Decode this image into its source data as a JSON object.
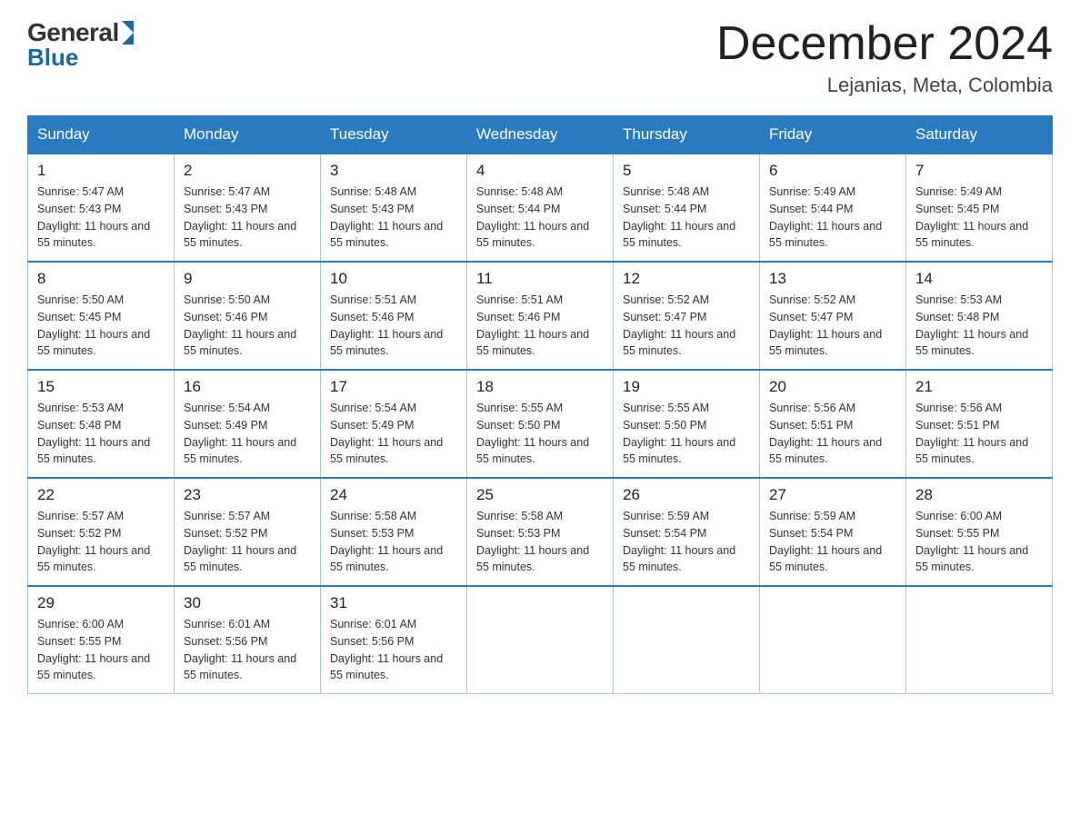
{
  "logo": {
    "general": "General",
    "blue": "Blue"
  },
  "header": {
    "month": "December 2024",
    "location": "Lejanias, Meta, Colombia"
  },
  "days_of_week": [
    "Sunday",
    "Monday",
    "Tuesday",
    "Wednesday",
    "Thursday",
    "Friday",
    "Saturday"
  ],
  "weeks": [
    {
      "days": [
        {
          "number": "1",
          "sunrise": "Sunrise: 5:47 AM",
          "sunset": "Sunset: 5:43 PM",
          "daylight": "Daylight: 11 hours and 55 minutes."
        },
        {
          "number": "2",
          "sunrise": "Sunrise: 5:47 AM",
          "sunset": "Sunset: 5:43 PM",
          "daylight": "Daylight: 11 hours and 55 minutes."
        },
        {
          "number": "3",
          "sunrise": "Sunrise: 5:48 AM",
          "sunset": "Sunset: 5:43 PM",
          "daylight": "Daylight: 11 hours and 55 minutes."
        },
        {
          "number": "4",
          "sunrise": "Sunrise: 5:48 AM",
          "sunset": "Sunset: 5:44 PM",
          "daylight": "Daylight: 11 hours and 55 minutes."
        },
        {
          "number": "5",
          "sunrise": "Sunrise: 5:48 AM",
          "sunset": "Sunset: 5:44 PM",
          "daylight": "Daylight: 11 hours and 55 minutes."
        },
        {
          "number": "6",
          "sunrise": "Sunrise: 5:49 AM",
          "sunset": "Sunset: 5:44 PM",
          "daylight": "Daylight: 11 hours and 55 minutes."
        },
        {
          "number": "7",
          "sunrise": "Sunrise: 5:49 AM",
          "sunset": "Sunset: 5:45 PM",
          "daylight": "Daylight: 11 hours and 55 minutes."
        }
      ]
    },
    {
      "days": [
        {
          "number": "8",
          "sunrise": "Sunrise: 5:50 AM",
          "sunset": "Sunset: 5:45 PM",
          "daylight": "Daylight: 11 hours and 55 minutes."
        },
        {
          "number": "9",
          "sunrise": "Sunrise: 5:50 AM",
          "sunset": "Sunset: 5:46 PM",
          "daylight": "Daylight: 11 hours and 55 minutes."
        },
        {
          "number": "10",
          "sunrise": "Sunrise: 5:51 AM",
          "sunset": "Sunset: 5:46 PM",
          "daylight": "Daylight: 11 hours and 55 minutes."
        },
        {
          "number": "11",
          "sunrise": "Sunrise: 5:51 AM",
          "sunset": "Sunset: 5:46 PM",
          "daylight": "Daylight: 11 hours and 55 minutes."
        },
        {
          "number": "12",
          "sunrise": "Sunrise: 5:52 AM",
          "sunset": "Sunset: 5:47 PM",
          "daylight": "Daylight: 11 hours and 55 minutes."
        },
        {
          "number": "13",
          "sunrise": "Sunrise: 5:52 AM",
          "sunset": "Sunset: 5:47 PM",
          "daylight": "Daylight: 11 hours and 55 minutes."
        },
        {
          "number": "14",
          "sunrise": "Sunrise: 5:53 AM",
          "sunset": "Sunset: 5:48 PM",
          "daylight": "Daylight: 11 hours and 55 minutes."
        }
      ]
    },
    {
      "days": [
        {
          "number": "15",
          "sunrise": "Sunrise: 5:53 AM",
          "sunset": "Sunset: 5:48 PM",
          "daylight": "Daylight: 11 hours and 55 minutes."
        },
        {
          "number": "16",
          "sunrise": "Sunrise: 5:54 AM",
          "sunset": "Sunset: 5:49 PM",
          "daylight": "Daylight: 11 hours and 55 minutes."
        },
        {
          "number": "17",
          "sunrise": "Sunrise: 5:54 AM",
          "sunset": "Sunset: 5:49 PM",
          "daylight": "Daylight: 11 hours and 55 minutes."
        },
        {
          "number": "18",
          "sunrise": "Sunrise: 5:55 AM",
          "sunset": "Sunset: 5:50 PM",
          "daylight": "Daylight: 11 hours and 55 minutes."
        },
        {
          "number": "19",
          "sunrise": "Sunrise: 5:55 AM",
          "sunset": "Sunset: 5:50 PM",
          "daylight": "Daylight: 11 hours and 55 minutes."
        },
        {
          "number": "20",
          "sunrise": "Sunrise: 5:56 AM",
          "sunset": "Sunset: 5:51 PM",
          "daylight": "Daylight: 11 hours and 55 minutes."
        },
        {
          "number": "21",
          "sunrise": "Sunrise: 5:56 AM",
          "sunset": "Sunset: 5:51 PM",
          "daylight": "Daylight: 11 hours and 55 minutes."
        }
      ]
    },
    {
      "days": [
        {
          "number": "22",
          "sunrise": "Sunrise: 5:57 AM",
          "sunset": "Sunset: 5:52 PM",
          "daylight": "Daylight: 11 hours and 55 minutes."
        },
        {
          "number": "23",
          "sunrise": "Sunrise: 5:57 AM",
          "sunset": "Sunset: 5:52 PM",
          "daylight": "Daylight: 11 hours and 55 minutes."
        },
        {
          "number": "24",
          "sunrise": "Sunrise: 5:58 AM",
          "sunset": "Sunset: 5:53 PM",
          "daylight": "Daylight: 11 hours and 55 minutes."
        },
        {
          "number": "25",
          "sunrise": "Sunrise: 5:58 AM",
          "sunset": "Sunset: 5:53 PM",
          "daylight": "Daylight: 11 hours and 55 minutes."
        },
        {
          "number": "26",
          "sunrise": "Sunrise: 5:59 AM",
          "sunset": "Sunset: 5:54 PM",
          "daylight": "Daylight: 11 hours and 55 minutes."
        },
        {
          "number": "27",
          "sunrise": "Sunrise: 5:59 AM",
          "sunset": "Sunset: 5:54 PM",
          "daylight": "Daylight: 11 hours and 55 minutes."
        },
        {
          "number": "28",
          "sunrise": "Sunrise: 6:00 AM",
          "sunset": "Sunset: 5:55 PM",
          "daylight": "Daylight: 11 hours and 55 minutes."
        }
      ]
    },
    {
      "days": [
        {
          "number": "29",
          "sunrise": "Sunrise: 6:00 AM",
          "sunset": "Sunset: 5:55 PM",
          "daylight": "Daylight: 11 hours and 55 minutes."
        },
        {
          "number": "30",
          "sunrise": "Sunrise: 6:01 AM",
          "sunset": "Sunset: 5:56 PM",
          "daylight": "Daylight: 11 hours and 55 minutes."
        },
        {
          "number": "31",
          "sunrise": "Sunrise: 6:01 AM",
          "sunset": "Sunset: 5:56 PM",
          "daylight": "Daylight: 11 hours and 55 minutes."
        },
        null,
        null,
        null,
        null
      ]
    }
  ]
}
